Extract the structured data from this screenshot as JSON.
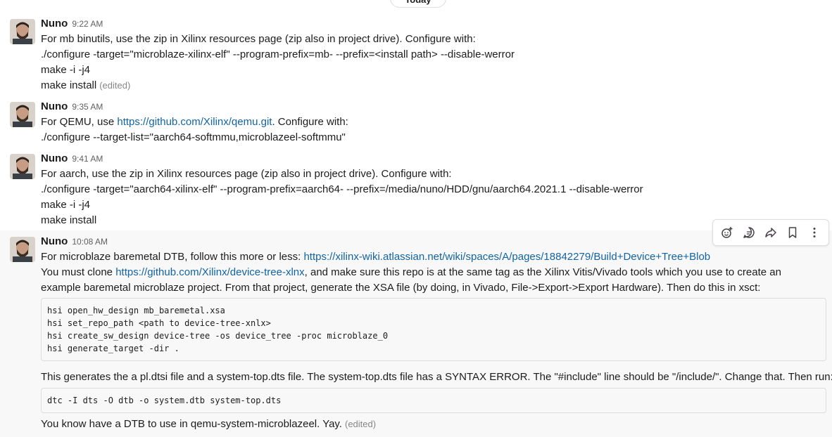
{
  "day_divider": "Today",
  "messages": [
    {
      "author": "Nuno",
      "time": "9:22 AM",
      "lines": [
        "For mb binutils, use the zip in Xilinx resources page (zip also in project drive). Configure with:",
        "./configure -target=\"microblaze-xilinx-elf\" --program-prefix=mb- --prefix=<install path> --disable-werror",
        "make -i -j4",
        "make install"
      ],
      "edited": "(edited)"
    },
    {
      "author": "Nuno",
      "time": "9:35 AM",
      "line1_pre": "For QEMU, use ",
      "line1_link": "https://github.com/Xilinx/qemu.git",
      "line1_post": ". Configure with:",
      "line2": "./configure --target-list=\"aarch64-softmmu,microblazeel-softmmu\""
    },
    {
      "author": "Nuno",
      "time": "9:41 AM",
      "lines": [
        "For aarch, use the zip in Xilinx resources page (zip also in project drive). Configure with:",
        "./configure -target=\"aarch64-xilinx-elf\" --program-prefix=aarch64- --prefix=/media/nuno/HDD/gnu/aarch64.2021.1 --disable-werror",
        "make -i -j4",
        "make install"
      ]
    },
    {
      "author": "Nuno",
      "time": "10:08 AM",
      "line1_pre": "For microblaze baremetal DTB, follow this more or less: ",
      "line1_link": "https://xilinx-wiki.atlassian.net/wiki/spaces/A/pages/18842279/Build+Device+Tree+Blob",
      "para2_pre": "You must clone ",
      "para2_link": "https://github.com/Xilinx/device-tree-xlnx",
      "para2_post": ", and make sure this repo is at the same tag as the Xilinx Vitis/Vivado tools which you use to create an example baremetal microblaze project. From that project, generate the XSA file (by doing, in Vivado, File->Export->Export Hardware). Then do this in xsct:",
      "code1": [
        "hsi open_hw_design mb_baremetal.xsa",
        "hsi set_repo_path <path to device-tree-xnlx>",
        "hsi create_sw_design device-tree -os device_tree -proc microblaze_0",
        "hsi generate_target -dir ."
      ],
      "para3": "This generates the a pl.dtsi file and a system-top.dts file. The system-top.dts file has a SYNTAX ERROR. The \"#include\" line should be \"/include/\". Change that. Then run:",
      "code2": "dtc -I dts -O dtb -o system.dtb system-top.dts",
      "para4": "You know have a DTB to use in qemu-system-microblazeel. Yay.",
      "edited": "(edited)"
    }
  ],
  "toolbar_icons": [
    "add-reaction-icon",
    "reply-in-thread-icon",
    "share-icon",
    "bookmark-icon",
    "more-actions-icon"
  ],
  "colors": {
    "link": "#1264a3",
    "text": "#1d1c1d",
    "muted": "#616061",
    "hover_bg": "#f8f8f8"
  }
}
